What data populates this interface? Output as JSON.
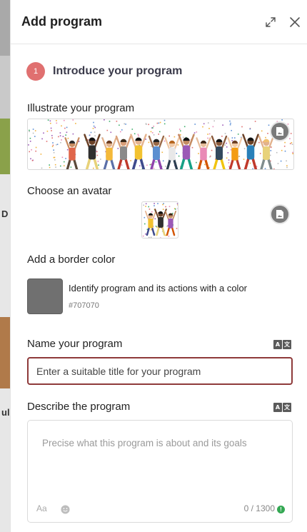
{
  "background": {
    "visible_letters": [
      "D",
      "ul"
    ]
  },
  "panel": {
    "title": "Add program",
    "step": {
      "number": "1",
      "title": "Introduce your program"
    },
    "illustration": {
      "label": "Illustrate your program"
    },
    "avatar": {
      "label": "Choose an avatar"
    },
    "border_color": {
      "label": "Add a border color",
      "description": "Identify program and its actions with a color",
      "value": "#707070"
    },
    "name": {
      "label": "Name your program",
      "placeholder": "Enter a suitable title for your program",
      "value": ""
    },
    "description": {
      "label": "Describe the program",
      "placeholder": "Precise what this program is about and its goals",
      "value": "",
      "format_label": "Aa",
      "counter": "0 / 1300"
    }
  },
  "icons": {
    "expand": "expand-icon",
    "close": "close-icon",
    "image_picker": "image-picker-icon",
    "translate": "translate-icon",
    "emoji": "emoji-icon",
    "valid": "check-circle-icon"
  },
  "colors": {
    "step_badge": "#e07070",
    "input_border_active": "#8e3a3a",
    "swatch": "#707070"
  }
}
